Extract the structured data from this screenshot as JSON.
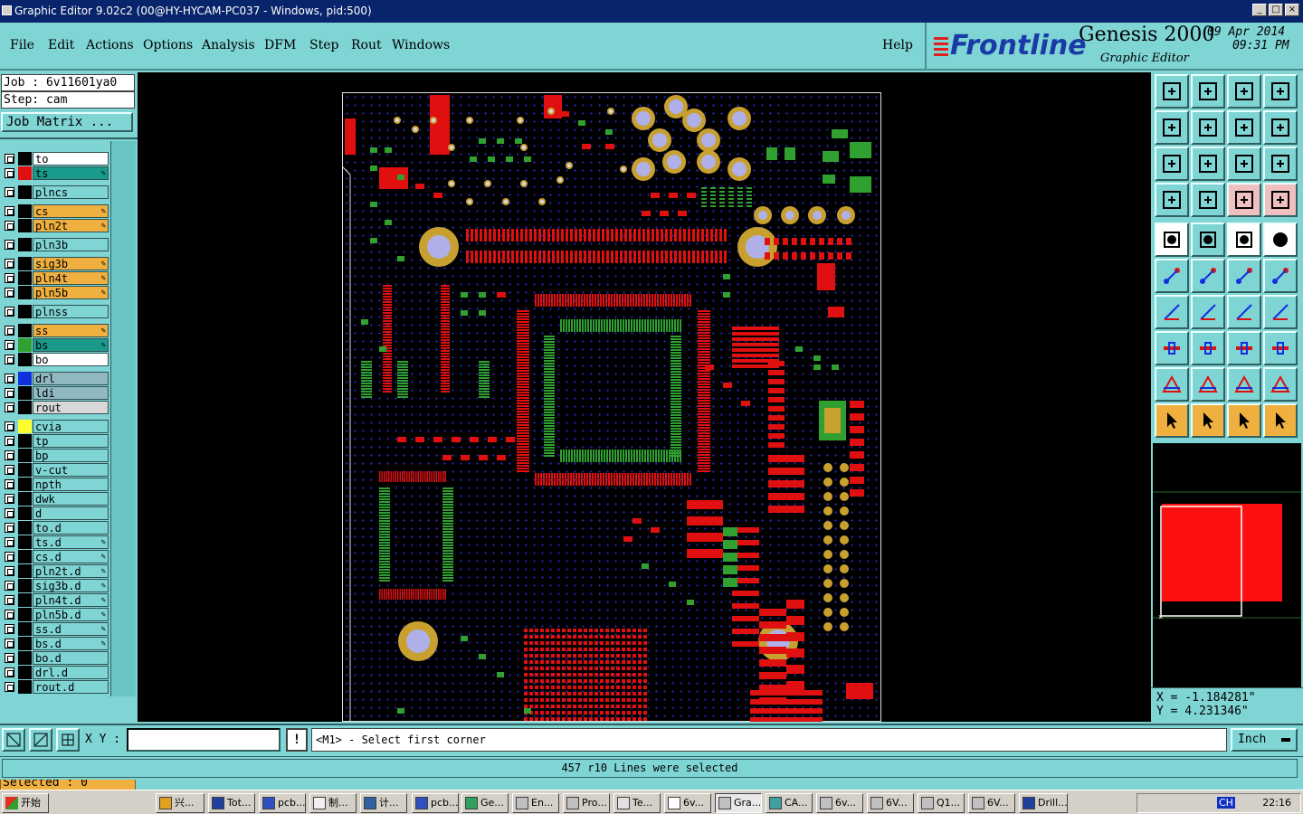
{
  "window": {
    "title": "Graphic Editor 9.02c2 (00@HY-HYCAM-PC037 - Windows, pid:500)"
  },
  "menu": {
    "file": "File",
    "edit": "Edit",
    "actions": "Actions",
    "options": "Options",
    "analysis": "Analysis",
    "dfm": "DFM",
    "step": "Step",
    "rout": "Rout",
    "windows": "Windows",
    "help": "Help"
  },
  "brand": {
    "logo": "Frontline",
    "product": "Genesis 2000",
    "subtitle": "Graphic Editor",
    "date": "09 Apr 2014",
    "time": "09:31 PM"
  },
  "job": {
    "job_line": "Job : 6v11601ya0",
    "step_line": "Step: cam",
    "matrix_label": "Job Matrix ..."
  },
  "layers": [
    {
      "name": "to",
      "color": "#ffffff",
      "swatch": "#000000",
      "editable": false
    },
    {
      "name": "ts",
      "color": "#1a9a8a",
      "swatch": "#e01010",
      "editable": true
    },
    {
      "name": "plncs",
      "color": "#7fd4d4",
      "swatch": "#000000",
      "editable": false
    },
    {
      "name": "cs",
      "color": "#f0b040",
      "swatch": "#000000",
      "editable": true
    },
    {
      "name": "pln2t",
      "color": "#f0b040",
      "swatch": "#000000",
      "editable": true
    },
    {
      "name": "pln3b",
      "color": "#7fd4d4",
      "swatch": "#000000",
      "editable": false
    },
    {
      "name": "sig3b",
      "color": "#f0b040",
      "swatch": "#000000",
      "editable": true
    },
    {
      "name": "pln4t",
      "color": "#f0b040",
      "swatch": "#000000",
      "editable": true
    },
    {
      "name": "pln5b",
      "color": "#f0b040",
      "swatch": "#000000",
      "editable": true
    },
    {
      "name": "plnss",
      "color": "#7fd4d4",
      "swatch": "#000000",
      "editable": false
    },
    {
      "name": "ss",
      "color": "#f0b040",
      "swatch": "#000000",
      "editable": true
    },
    {
      "name": "bs",
      "color": "#1a9a8a",
      "swatch": "#30a030",
      "editable": true
    },
    {
      "name": "bo",
      "color": "#ffffff",
      "swatch": "#000000",
      "editable": false
    },
    {
      "name": "drl",
      "color": "#90b8c0",
      "swatch": "#1030e0",
      "editable": false
    },
    {
      "name": "ldi",
      "color": "#90b8c0",
      "swatch": "#000000",
      "editable": false
    },
    {
      "name": "rout",
      "color": "#d8d8d8",
      "swatch": "#000000",
      "editable": false
    },
    {
      "name": "cvia",
      "color": "#7fd4d4",
      "swatch": "#ffff30",
      "editable": false
    },
    {
      "name": "tp",
      "color": "#7fd4d4",
      "swatch": "#000000",
      "editable": false
    },
    {
      "name": "bp",
      "color": "#7fd4d4",
      "swatch": "#000000",
      "editable": false
    },
    {
      "name": "v-cut",
      "color": "#7fd4d4",
      "swatch": "#000000",
      "editable": false
    },
    {
      "name": "npth",
      "color": "#7fd4d4",
      "swatch": "#000000",
      "editable": false
    },
    {
      "name": "dwk",
      "color": "#7fd4d4",
      "swatch": "#000000",
      "editable": false
    },
    {
      "name": "d",
      "color": "#7fd4d4",
      "swatch": "#000000",
      "editable": false
    },
    {
      "name": "to.d",
      "color": "#7fd4d4",
      "swatch": "#000000",
      "editable": false
    },
    {
      "name": "ts.d",
      "color": "#7fd4d4",
      "swatch": "#000000",
      "editable": true
    },
    {
      "name": "cs.d",
      "color": "#7fd4d4",
      "swatch": "#000000",
      "editable": true
    },
    {
      "name": "pln2t.d",
      "color": "#7fd4d4",
      "swatch": "#000000",
      "editable": true
    },
    {
      "name": "sig3b.d",
      "color": "#7fd4d4",
      "swatch": "#000000",
      "editable": true
    },
    {
      "name": "pln4t.d",
      "color": "#7fd4d4",
      "swatch": "#000000",
      "editable": true
    },
    {
      "name": "pln5b.d",
      "color": "#7fd4d4",
      "swatch": "#000000",
      "editable": true
    },
    {
      "name": "ss.d",
      "color": "#7fd4d4",
      "swatch": "#000000",
      "editable": true
    },
    {
      "name": "bs.d",
      "color": "#7fd4d4",
      "swatch": "#000000",
      "editable": true
    },
    {
      "name": "bo.d",
      "color": "#7fd4d4",
      "swatch": "#000000",
      "editable": false
    },
    {
      "name": "drl.d",
      "color": "#7fd4d4",
      "swatch": "#000000",
      "editable": false
    },
    {
      "name": "rout.d",
      "color": "#7fd4d4",
      "swatch": "#000000",
      "editable": false
    }
  ],
  "selected": "Selected : 0",
  "coords": {
    "x": "X = -1.184281\"",
    "y": "Y = 4.231346\""
  },
  "command": {
    "xy_label": "X Y :",
    "xy_value": "",
    "bang": "!",
    "prompt": "<M1> - Select first corner",
    "units": "Inch"
  },
  "status": "457 r10 Lines were selected",
  "taskbar": {
    "start": "开始",
    "tasks": [
      "兴...",
      "Tot...",
      "pcb...",
      "制...",
      "计...",
      "pcb...",
      "Ge...",
      "En...",
      "Pro...",
      "Te...",
      "6v...",
      "Gra...",
      "CA...",
      "6v...",
      "6V...",
      "Q1...",
      "6V...",
      "Drill..."
    ],
    "active_index": 11,
    "tray_lang": "CH",
    "clock": "22:16"
  },
  "colors": {
    "panel": "#7fd4d4",
    "accent_orange": "#f0b040",
    "title_bar": "#08246b",
    "pad_red": "#e01010",
    "pad_green": "#30a030",
    "pad_gold": "#c8a030"
  }
}
